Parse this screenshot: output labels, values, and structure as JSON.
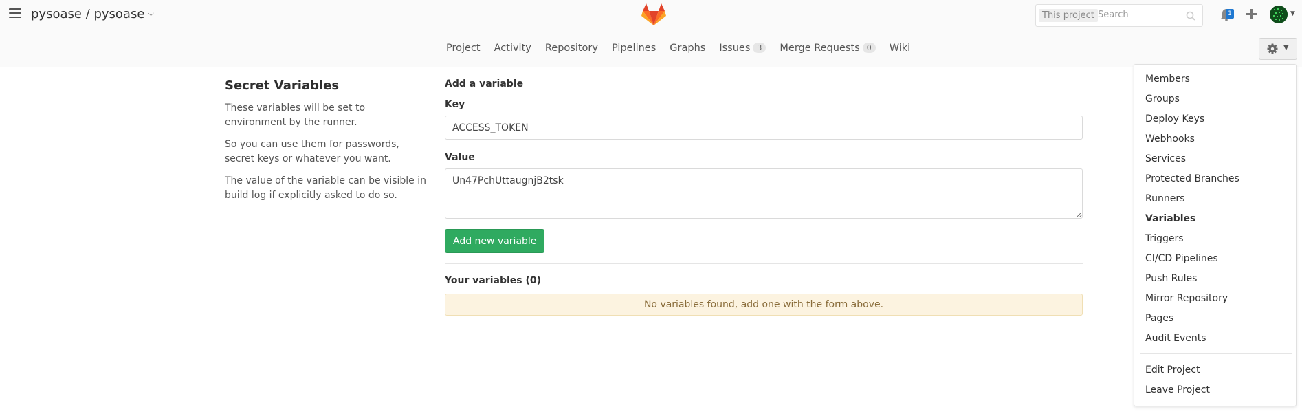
{
  "header": {
    "project_title": "pysoase / pysoase",
    "search_scope": "This project",
    "search_placeholder": "Search",
    "notification_count": "1",
    "colors": {
      "brand_orange": "#e24329",
      "notification_blue": "#1f78d1"
    },
    "icons": [
      "hamburger-icon",
      "gitlab-logo",
      "search-icon",
      "bell-icon",
      "plus-icon",
      "avatar"
    ]
  },
  "nav": {
    "links": [
      {
        "label": "Project"
      },
      {
        "label": "Activity"
      },
      {
        "label": "Repository"
      },
      {
        "label": "Pipelines"
      },
      {
        "label": "Graphs"
      },
      {
        "label": "Issues",
        "count": "3"
      },
      {
        "label": "Merge Requests",
        "count": "0"
      },
      {
        "label": "Wiki"
      }
    ],
    "settings_icon": "gear-icon"
  },
  "sidebar": {
    "title": "Secret Variables",
    "paragraphs": [
      "These variables will be set to environment by the runner.",
      "So you can use them for passwords, secret keys or whatever you want.",
      "The value of the variable can be visible in build log if explicitly asked to do so."
    ]
  },
  "form": {
    "heading": "Add a variable",
    "key_label": "Key",
    "key_value": "ACCESS_TOKEN",
    "value_label": "Value",
    "value_value": "Un47PchUttaugnjB2tsk",
    "submit_label": "Add new variable",
    "submit_color": "#2faa60"
  },
  "variables": {
    "heading": "Your variables (0)",
    "empty_message": "No variables found, add one with the form above.",
    "empty_bg_color": "#fcf3e0"
  },
  "settings_menu": {
    "items": [
      {
        "label": "Members"
      },
      {
        "label": "Groups"
      },
      {
        "label": "Deploy Keys"
      },
      {
        "label": "Webhooks"
      },
      {
        "label": "Services"
      },
      {
        "label": "Protected Branches"
      },
      {
        "label": "Runners"
      },
      {
        "label": "Variables",
        "active": true
      },
      {
        "label": "Triggers"
      },
      {
        "label": "CI/CD Pipelines"
      },
      {
        "label": "Push Rules"
      },
      {
        "label": "Mirror Repository"
      },
      {
        "label": "Pages"
      },
      {
        "label": "Audit Events"
      }
    ],
    "footer_items": [
      {
        "label": "Edit Project"
      },
      {
        "label": "Leave Project"
      }
    ]
  }
}
